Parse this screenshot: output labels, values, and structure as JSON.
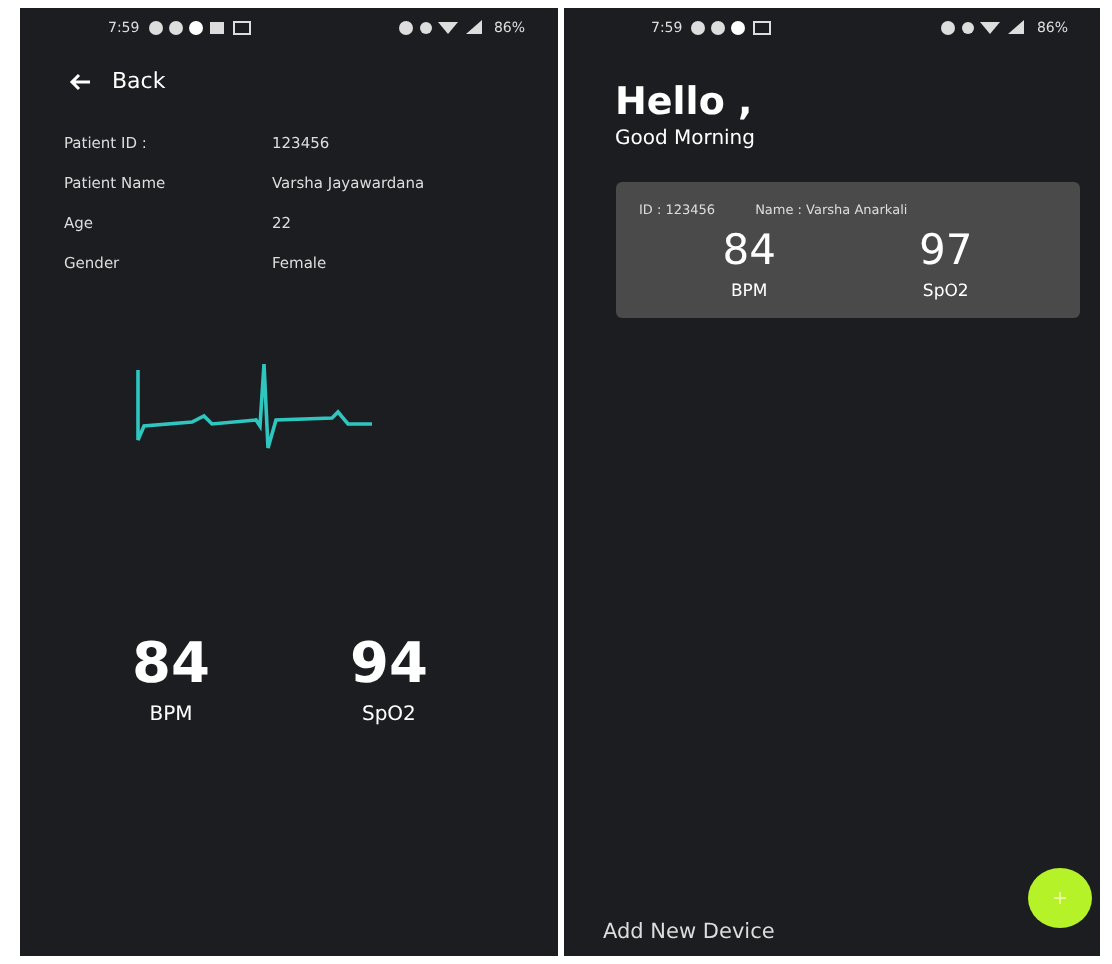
{
  "screens": [
    {
      "status_bar": {
        "time": "7:59",
        "battery": "86%"
      },
      "back": {
        "label": "Back"
      },
      "patient_info": [
        {
          "label": "Patient ID :",
          "value": "123456"
        },
        {
          "label": "Patient Name",
          "value": "Varsha Jayawardana"
        },
        {
          "label": "Age",
          "value": "22"
        },
        {
          "label": "Gender",
          "value": "Female"
        }
      ],
      "vitals": [
        {
          "value": "84",
          "unit": "BPM"
        },
        {
          "value": "94",
          "unit": "SpO2"
        }
      ]
    },
    {
      "status_bar": {
        "time": "7:59",
        "battery": "86%"
      },
      "greeting": "Hello ,",
      "subtitle": "Good Morning",
      "card": {
        "id": "ID : 123456",
        "name": "Name : Varsha Anarkali",
        "vitals": [
          {
            "value": "84",
            "unit": "BPM"
          },
          {
            "value": "97",
            "unit": "SpO2"
          }
        ]
      },
      "add_device": "Add New Device"
    }
  ]
}
